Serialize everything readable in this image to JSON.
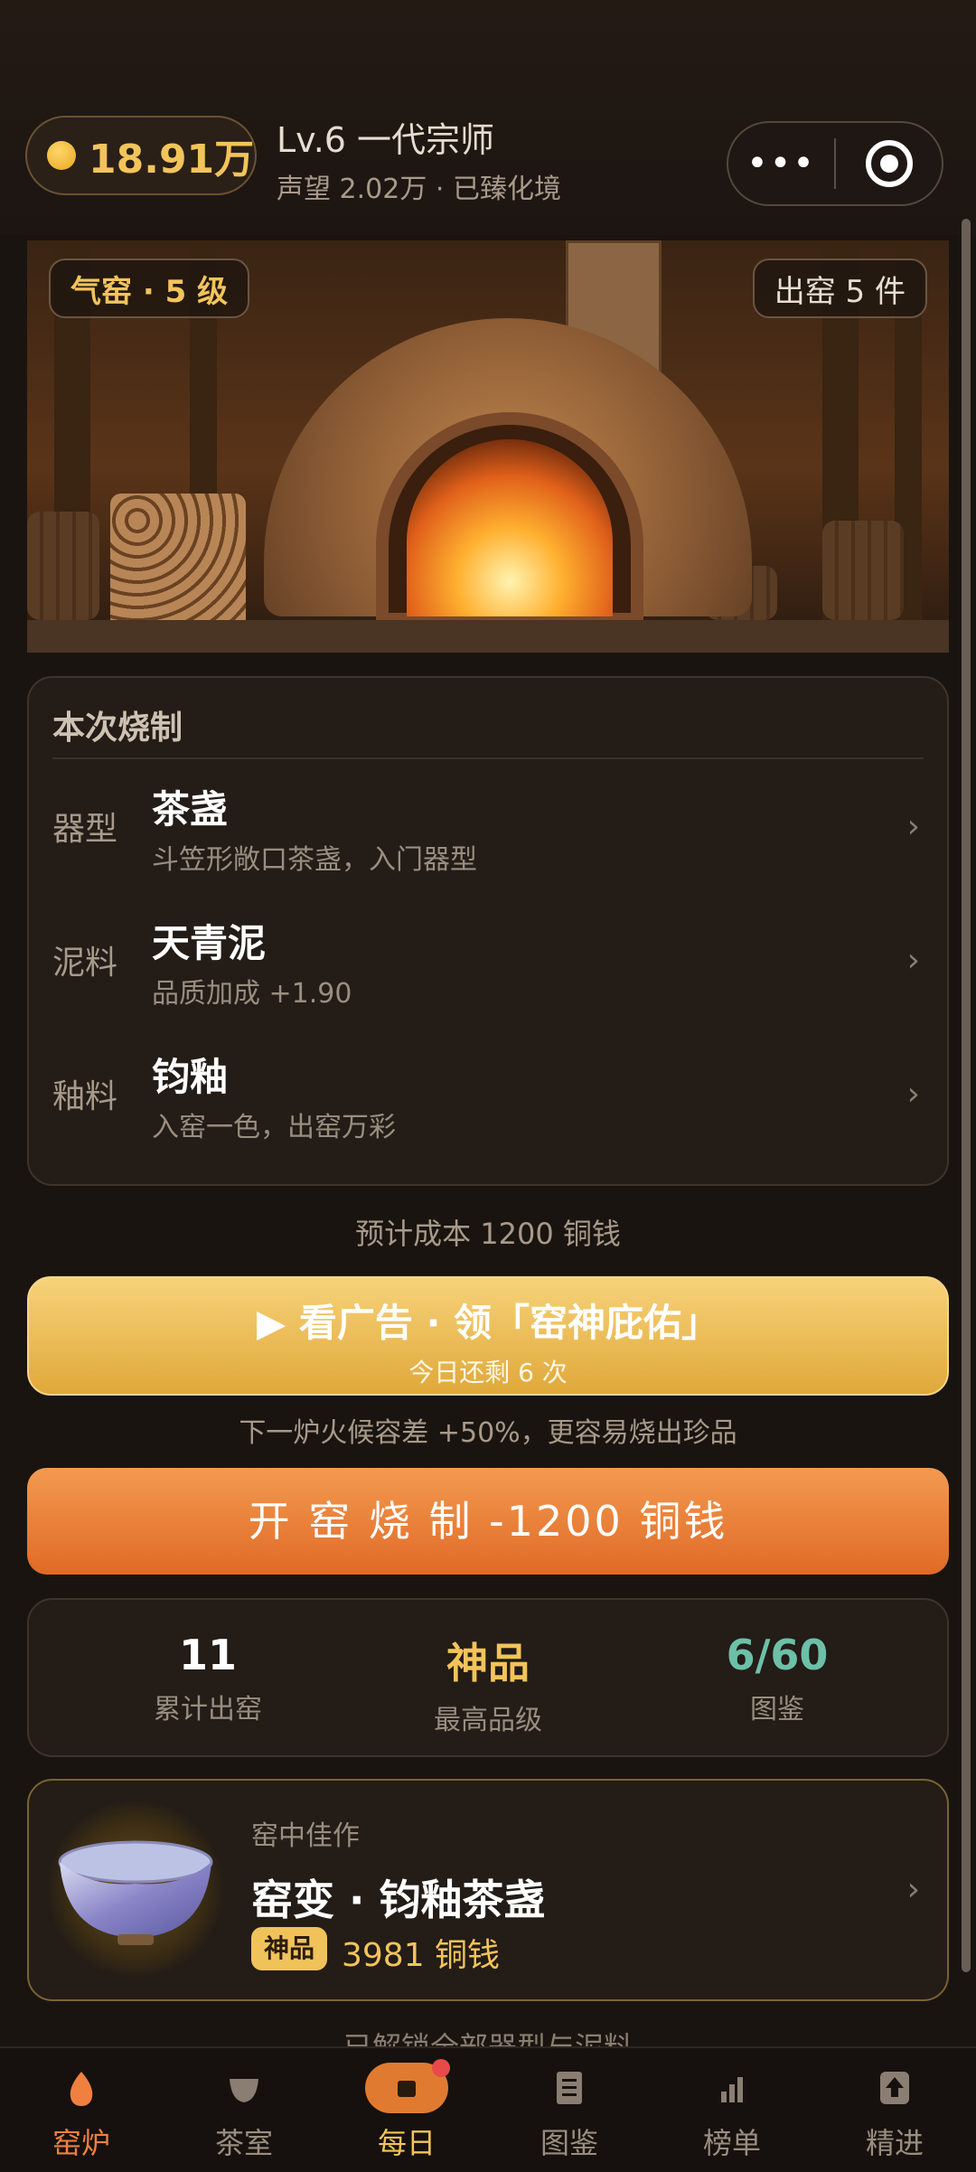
{
  "header": {
    "coins": "18.91万",
    "level": "Lv.6 一代宗师",
    "reputation": "声望 2.02万 · 已臻化境",
    "more_icon": "more-dots-icon",
    "record_icon": "record-icon"
  },
  "hero": {
    "kiln_badge": "气窑 · 5 级",
    "output_badge": "出窑 5 件"
  },
  "firing": {
    "title": "本次烧制",
    "rows": [
      {
        "label": "器型",
        "name": "茶盏",
        "desc": "斗笠形敞口茶盏，入门器型"
      },
      {
        "label": "泥料",
        "name": "天青泥",
        "desc": "品质加成 +1.90"
      },
      {
        "label": "釉料",
        "name": "钧釉",
        "desc": "入窑一色，出窑万彩"
      }
    ],
    "chevron": "›"
  },
  "cost_text": "预计成本 1200 铜钱",
  "ad": {
    "main": "▶ 看广告 · 领「窑神庇佑」",
    "sub": "今日还剩 6 次",
    "hint": "下一炉火候容差 +50%，更容易烧出珍品"
  },
  "fire_button": "开 窑 烧 制   -1200 铜钱",
  "stats": [
    {
      "value": "11",
      "label": "累计出窑",
      "color": "#ffffff"
    },
    {
      "value": "神品",
      "label": "最高品级",
      "color": "#f3c45a"
    },
    {
      "value": "6/60",
      "label": "图鉴",
      "color": "#6cc0a8"
    }
  ],
  "masterpiece": {
    "pre": "窑中佳作",
    "name": "窑变 · 钧釉茶盏",
    "tag": "神品",
    "price": "3981 铜钱"
  },
  "cut_text": "已解锁全部器型与泥料",
  "tabs": [
    {
      "label": "窑炉",
      "icon": "kiln-flame-icon",
      "active": true
    },
    {
      "label": "茶室",
      "icon": "tea-cup-icon",
      "active": false
    },
    {
      "label": "每日",
      "icon": "daily-gift-icon",
      "active": false
    },
    {
      "label": "图鉴",
      "icon": "catalog-book-icon",
      "active": false
    },
    {
      "label": "榜单",
      "icon": "ranking-bars-icon",
      "active": false
    },
    {
      "label": "精进",
      "icon": "upgrade-arrow-icon",
      "active": false
    }
  ]
}
